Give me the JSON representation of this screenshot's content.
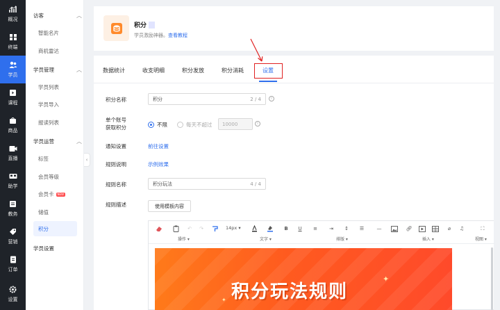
{
  "rail": [
    {
      "label": "概况",
      "icon": "chart-icon"
    },
    {
      "label": "终端",
      "icon": "terminal-icon"
    },
    {
      "label": "学员",
      "icon": "users-icon"
    },
    {
      "label": "课程",
      "icon": "course-icon"
    },
    {
      "label": "商品",
      "icon": "goods-icon"
    },
    {
      "label": "直播",
      "icon": "live-icon"
    },
    {
      "label": "助学",
      "icon": "study-icon"
    },
    {
      "label": "教务",
      "icon": "academic-icon"
    },
    {
      "label": "营销",
      "icon": "marketing-icon"
    },
    {
      "label": "订单",
      "icon": "order-icon"
    },
    {
      "label": "设置",
      "icon": "settings-icon"
    }
  ],
  "submenu": {
    "group1": "访客",
    "g1_items": [
      "智能名片",
      "商机雷达"
    ],
    "group2": "学员管理",
    "g2_items": [
      "学员列表",
      "学员导入",
      "报读列表"
    ],
    "group3": "学员运营",
    "g3_items": [
      "标签",
      "会员等级",
      "会员卡",
      "储值",
      "积分"
    ],
    "new_badge": "NEW",
    "group4": "学员设置"
  },
  "header": {
    "title": "积分",
    "subtitle": "学员激励神器。",
    "tutorial_link": "查看教程"
  },
  "tabs": [
    "数据统计",
    "收支明细",
    "积分发放",
    "积分消耗",
    "设置"
  ],
  "form": {
    "name_label": "积分名称",
    "name_value": "积分",
    "name_count": "2 / 4",
    "limit_label_line1": "单个账号",
    "limit_label_line2": "获取积分",
    "radio_unlimited": "不限",
    "radio_daily": "每天不超过",
    "daily_placeholder": "10000",
    "notify_label": "通知设置",
    "notify_link": "前往设置",
    "rule_desc_label": "规则说明",
    "example_link": "示例效果",
    "rule_name_label": "规则名称",
    "rule_name_value": "积分玩法",
    "rule_name_count": "4 / 4",
    "rule_detail_label": "规则描述",
    "template_button": "使用模板内容"
  },
  "editor": {
    "font_size": "14px",
    "groups": {
      "operate": "操作",
      "text": "文字",
      "layout": "排版",
      "insert": "插入",
      "view": "视图"
    },
    "banner_text": "积分玩法规则"
  },
  "colors": {
    "accent": "#2f6fed",
    "rail_bg": "#1f2329",
    "annotation": "#e02020",
    "banner": "#ff5a1f"
  }
}
